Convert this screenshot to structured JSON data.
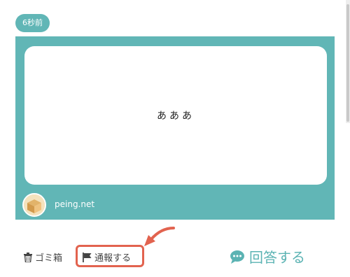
{
  "post": {
    "time_ago": "6秒前",
    "question_text": "あああ",
    "site": "peing.net"
  },
  "actions": {
    "trash_label": "ゴミ箱",
    "report_label": "通報する",
    "answer_label": "回答する"
  },
  "colors": {
    "card": "#61b6b6",
    "accent": "#5bb3b3",
    "highlight": "#e2634f"
  },
  "icons": [
    "trash-icon",
    "flag-icon",
    "speech-bubble-icon",
    "box-avatar-icon"
  ]
}
